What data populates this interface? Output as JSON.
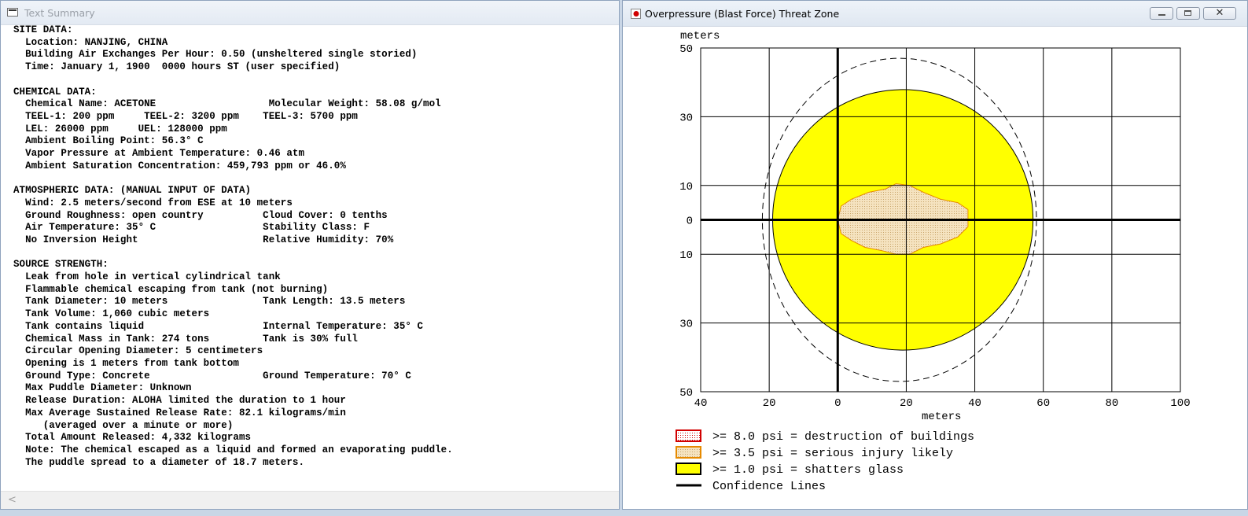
{
  "summary_window": {
    "title": "Text Summary",
    "lines": [
      "SITE DATA:",
      "  Location: NANJING, CHINA",
      "  Building Air Exchanges Per Hour: 0.50 (unsheltered single storied)",
      "  Time: January 1, 1900  0000 hours ST (user specified)",
      "",
      "CHEMICAL DATA:",
      "  Chemical Name: ACETONE                   Molecular Weight: 58.08 g/mol",
      "  TEEL-1: 200 ppm     TEEL-2: 3200 ppm    TEEL-3: 5700 ppm",
      "  LEL: 26000 ppm     UEL: 128000 ppm",
      "  Ambient Boiling Point: 56.3° C",
      "  Vapor Pressure at Ambient Temperature: 0.46 atm",
      "  Ambient Saturation Concentration: 459,793 ppm or 46.0%",
      "",
      "ATMOSPHERIC DATA: (MANUAL INPUT OF DATA)",
      "  Wind: 2.5 meters/second from ESE at 10 meters",
      "  Ground Roughness: open country          Cloud Cover: 0 tenths",
      "  Air Temperature: 35° C                  Stability Class: F",
      "  No Inversion Height                     Relative Humidity: 70%",
      "",
      "SOURCE STRENGTH:",
      "  Leak from hole in vertical cylindrical tank",
      "  Flammable chemical escaping from tank (not burning)",
      "  Tank Diameter: 10 meters                Tank Length: 13.5 meters",
      "  Tank Volume: 1,060 cubic meters",
      "  Tank contains liquid                    Internal Temperature: 35° C",
      "  Chemical Mass in Tank: 274 tons         Tank is 30% full",
      "  Circular Opening Diameter: 5 centimeters",
      "  Opening is 1 meters from tank bottom",
      "  Ground Type: Concrete                   Ground Temperature: 70° C",
      "  Max Puddle Diameter: Unknown",
      "  Release Duration: ALOHA limited the duration to 1 hour",
      "  Max Average Sustained Release Rate: 82.1 kilograms/min",
      "     (averaged over a minute or more)",
      "  Total Amount Released: 4,332 kilograms",
      "  Note: The chemical escaped as a liquid and formed an evaporating puddle.",
      "  The puddle spread to a diameter of 18.7 meters."
    ],
    "scroll_left_glyph": "<"
  },
  "threat_window": {
    "title": "Overpressure (Blast Force) Threat Zone",
    "close_glyph": "✕",
    "y_unit_label": "meters",
    "x_unit_label": "meters",
    "y_tick_labels": [
      "50",
      "30",
      "10",
      "0",
      "10",
      "30",
      "50"
    ],
    "x_tick_labels": [
      "40",
      "20",
      "0",
      "20",
      "40",
      "60",
      "80",
      "100"
    ],
    "legend": [
      {
        "label": ">= 8.0 psi = destruction of buildings",
        "swatch": "red-dotted"
      },
      {
        "label": ">= 3.5 psi = serious injury likely",
        "swatch": "orange-dotted"
      },
      {
        "label": ">= 1.0 psi = shatters glass",
        "swatch": "yellow"
      },
      {
        "label": "Confidence Lines",
        "swatch": "line"
      }
    ],
    "colors": {
      "yellow_zone": "#ffff00",
      "orange_zone": "#f5deb3",
      "orange_border": "#e68a00",
      "red_border": "#d10000",
      "grid": "#000000"
    }
  },
  "chart_data": {
    "type": "area",
    "title": "Overpressure (Blast Force) Threat Zone",
    "xlabel": "meters",
    "ylabel": "meters",
    "xlim": [
      -40,
      100
    ],
    "ylim": [
      -50,
      50
    ],
    "grid": true,
    "legend_placement": "bottom",
    "series": [
      {
        "name": ">= 1.0 psi = shatters glass",
        "shape": "circle",
        "center": [
          19,
          0
        ],
        "radius": 38
      },
      {
        "name": ">= 3.5 psi = serious injury likely",
        "shape": "blob",
        "x_range": [
          0,
          38
        ],
        "y_range": [
          -10,
          10
        ]
      },
      {
        "name": "Confidence Lines",
        "shape": "ellipse",
        "center": [
          18,
          0
        ],
        "rx": 40,
        "ry": 47
      }
    ]
  }
}
